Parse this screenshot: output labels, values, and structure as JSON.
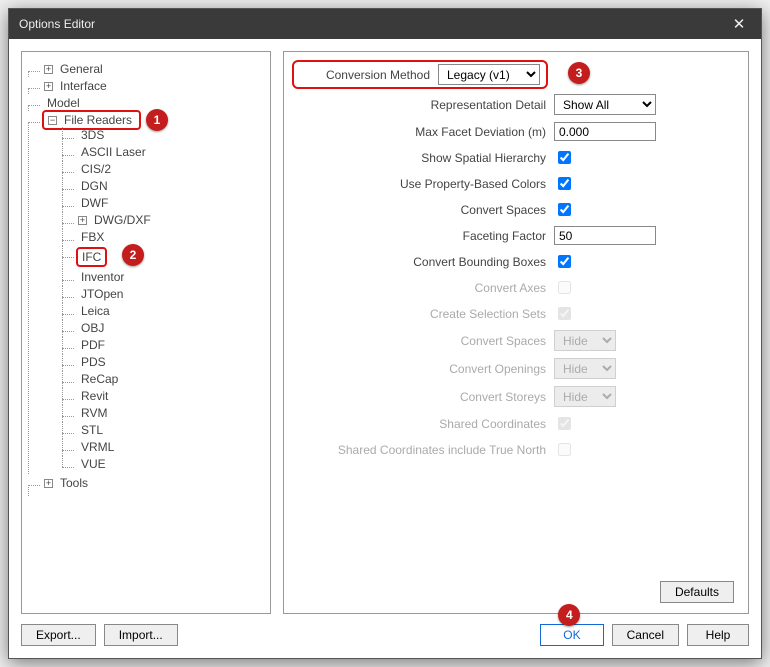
{
  "window": {
    "title": "Options Editor"
  },
  "tree": {
    "general": "General",
    "interface": "Interface",
    "model": "Model",
    "file_readers": "File Readers",
    "children": [
      "3DS",
      "ASCII Laser",
      "CIS/2",
      "DGN",
      "DWF",
      "DWG/DXF",
      "FBX",
      "IFC",
      "Inventor",
      "JTOpen",
      "Leica",
      "OBJ",
      "PDF",
      "PDS",
      "ReCap",
      "Revit",
      "RVM",
      "STL",
      "VRML",
      "VUE"
    ],
    "tools": "Tools"
  },
  "form": {
    "conversion_method": {
      "label": "Conversion Method",
      "value": "Legacy (v1)"
    },
    "representation_detail": {
      "label": "Representation Detail",
      "value": "Show All"
    },
    "max_facet_deviation": {
      "label": "Max Facet Deviation (m)",
      "value": "0.000"
    },
    "show_spatial_hierarchy": {
      "label": "Show Spatial Hierarchy",
      "checked": true
    },
    "use_property_colors": {
      "label": "Use Property-Based Colors",
      "checked": true
    },
    "convert_spaces1": {
      "label": "Convert Spaces",
      "checked": true
    },
    "faceting_factor": {
      "label": "Faceting Factor",
      "value": "50"
    },
    "convert_bboxes": {
      "label": "Convert Bounding Boxes",
      "checked": true
    },
    "convert_axes": {
      "label": "Convert Axes",
      "checked": false
    },
    "create_selection_sets": {
      "label": "Create Selection Sets",
      "checked": true
    },
    "convert_spaces2": {
      "label": "Convert Spaces",
      "value": "Hide"
    },
    "convert_openings": {
      "label": "Convert Openings",
      "value": "Hide"
    },
    "convert_storeys": {
      "label": "Convert Storeys",
      "value": "Hide"
    },
    "shared_coords": {
      "label": "Shared Coordinates",
      "checked": true
    },
    "shared_coords_tn": {
      "label": "Shared Coordinates include True North",
      "checked": false
    }
  },
  "buttons": {
    "defaults": "Defaults",
    "export": "Export...",
    "import": "Import...",
    "ok": "OK",
    "cancel": "Cancel",
    "help": "Help"
  },
  "badges": {
    "b1": "1",
    "b2": "2",
    "b3": "3",
    "b4": "4"
  }
}
